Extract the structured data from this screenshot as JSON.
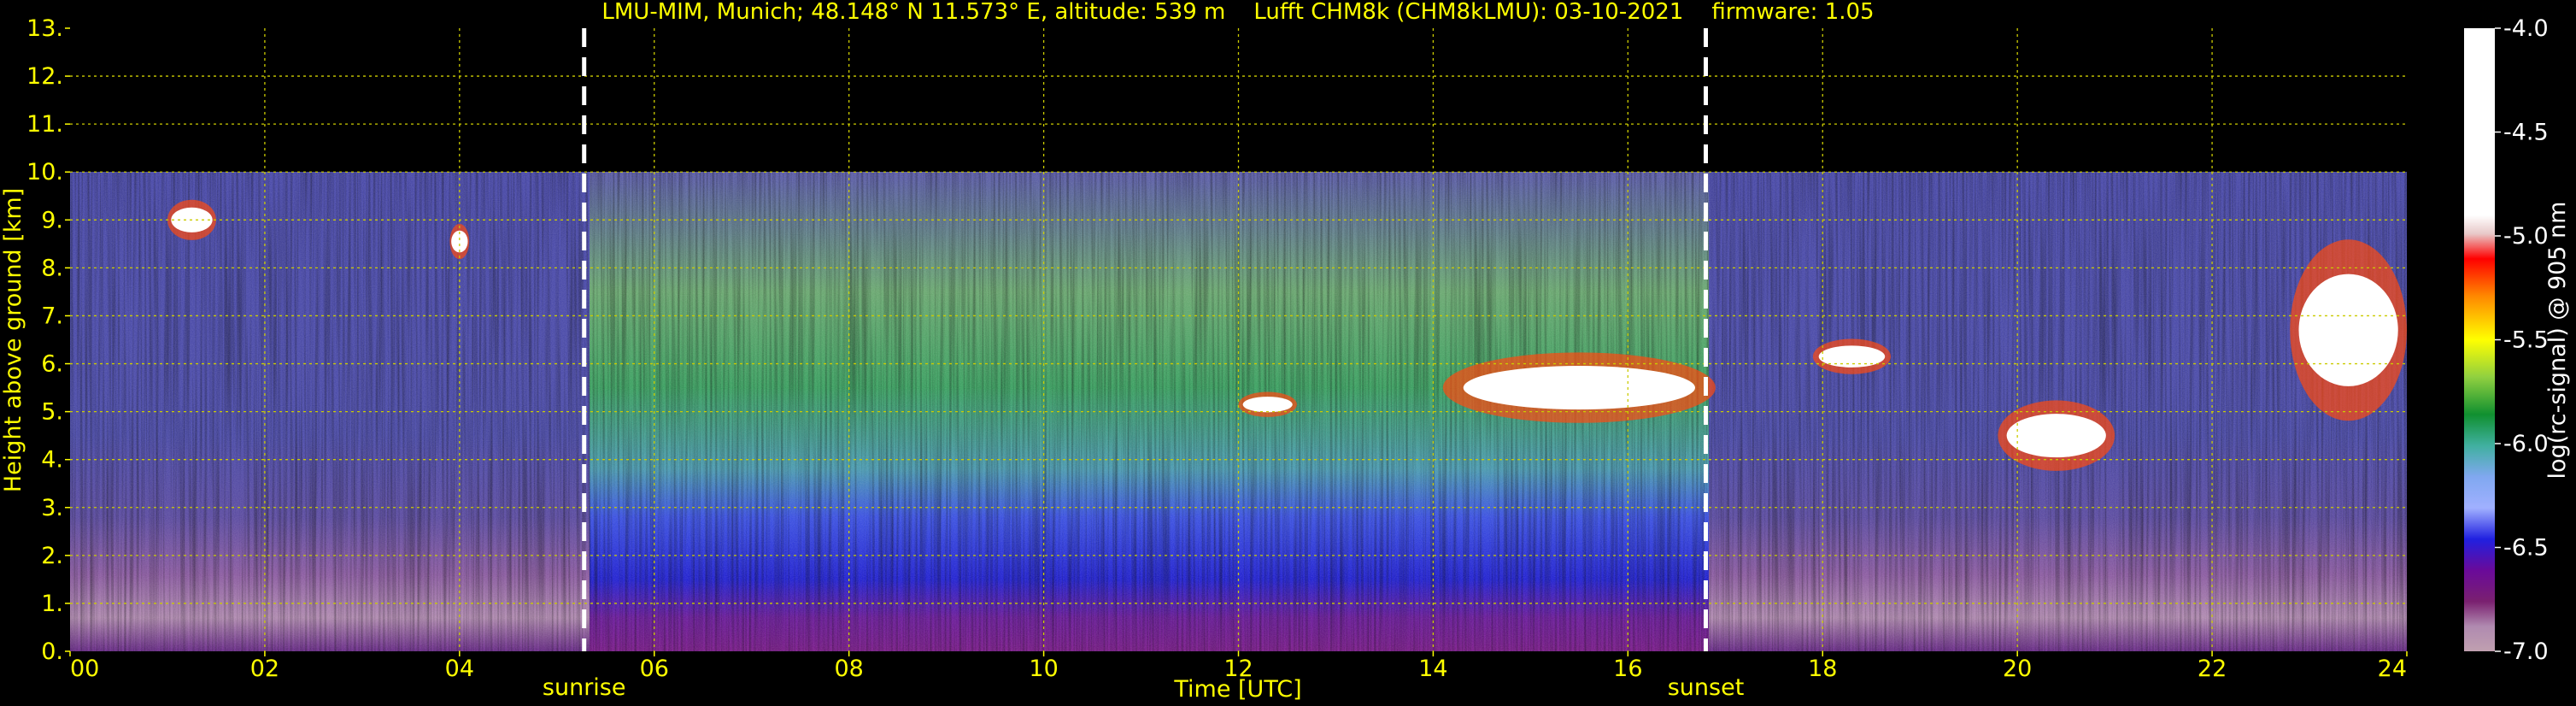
{
  "chart_data": {
    "type": "heatmap",
    "title": "LMU-MIM, Munich; 48.148° N 11.573° E, altitude: 539 m    Lufft CHM8k (CHM8kLMU): 03-10-2021    firmware: 1.05",
    "xlabel": "Time [UTC]",
    "ylabel": "Height above ground [km]",
    "xlim": [
      0,
      24
    ],
    "ylim": [
      0,
      13
    ],
    "x_ticks": [
      "00",
      "02",
      "04",
      "06",
      "08",
      "10",
      "12",
      "14",
      "16",
      "18",
      "20",
      "22",
      "24"
    ],
    "y_ticks": [
      "0.",
      "1.",
      "2.",
      "3.",
      "4.",
      "5.",
      "6.",
      "7.",
      "8.",
      "9.",
      "10.",
      "11.",
      "12.",
      "13."
    ],
    "grid": true,
    "data_top_km": 10,
    "annotations": [
      {
        "label": "sunrise",
        "x": 5.28
      },
      {
        "label": "sunset",
        "x": 16.8
      }
    ],
    "colorbar": {
      "label": "log(rc-signal) @ 905 nm",
      "range": [
        -7.0,
        -4.0
      ],
      "ticks": [
        "-4.0",
        "-4.5",
        "-5.0",
        "-5.5",
        "-6.0",
        "-6.5",
        "-7.0"
      ]
    },
    "cloud_layers": [
      {
        "x": [
          1.0,
          1.5
        ],
        "y": [
          8.6,
          9.4
        ]
      },
      {
        "x": [
          3.9,
          4.1
        ],
        "y": [
          8.2,
          8.9
        ]
      },
      {
        "x": [
          12.0,
          12.6
        ],
        "y": [
          4.9,
          5.4
        ]
      },
      {
        "x": [
          14.1,
          16.9
        ],
        "y": [
          4.8,
          6.2
        ]
      },
      {
        "x": [
          17.9,
          18.7
        ],
        "y": [
          5.8,
          6.5
        ]
      },
      {
        "x": [
          19.8,
          21.0
        ],
        "y": [
          3.8,
          5.2
        ]
      },
      {
        "x": [
          22.8,
          24.0
        ],
        "y": [
          4.9,
          8.5
        ]
      }
    ],
    "colors": {
      "text": "#ffff00",
      "grid": "#cccc00",
      "sun_line": "#ffffff",
      "background": "#000000"
    }
  }
}
